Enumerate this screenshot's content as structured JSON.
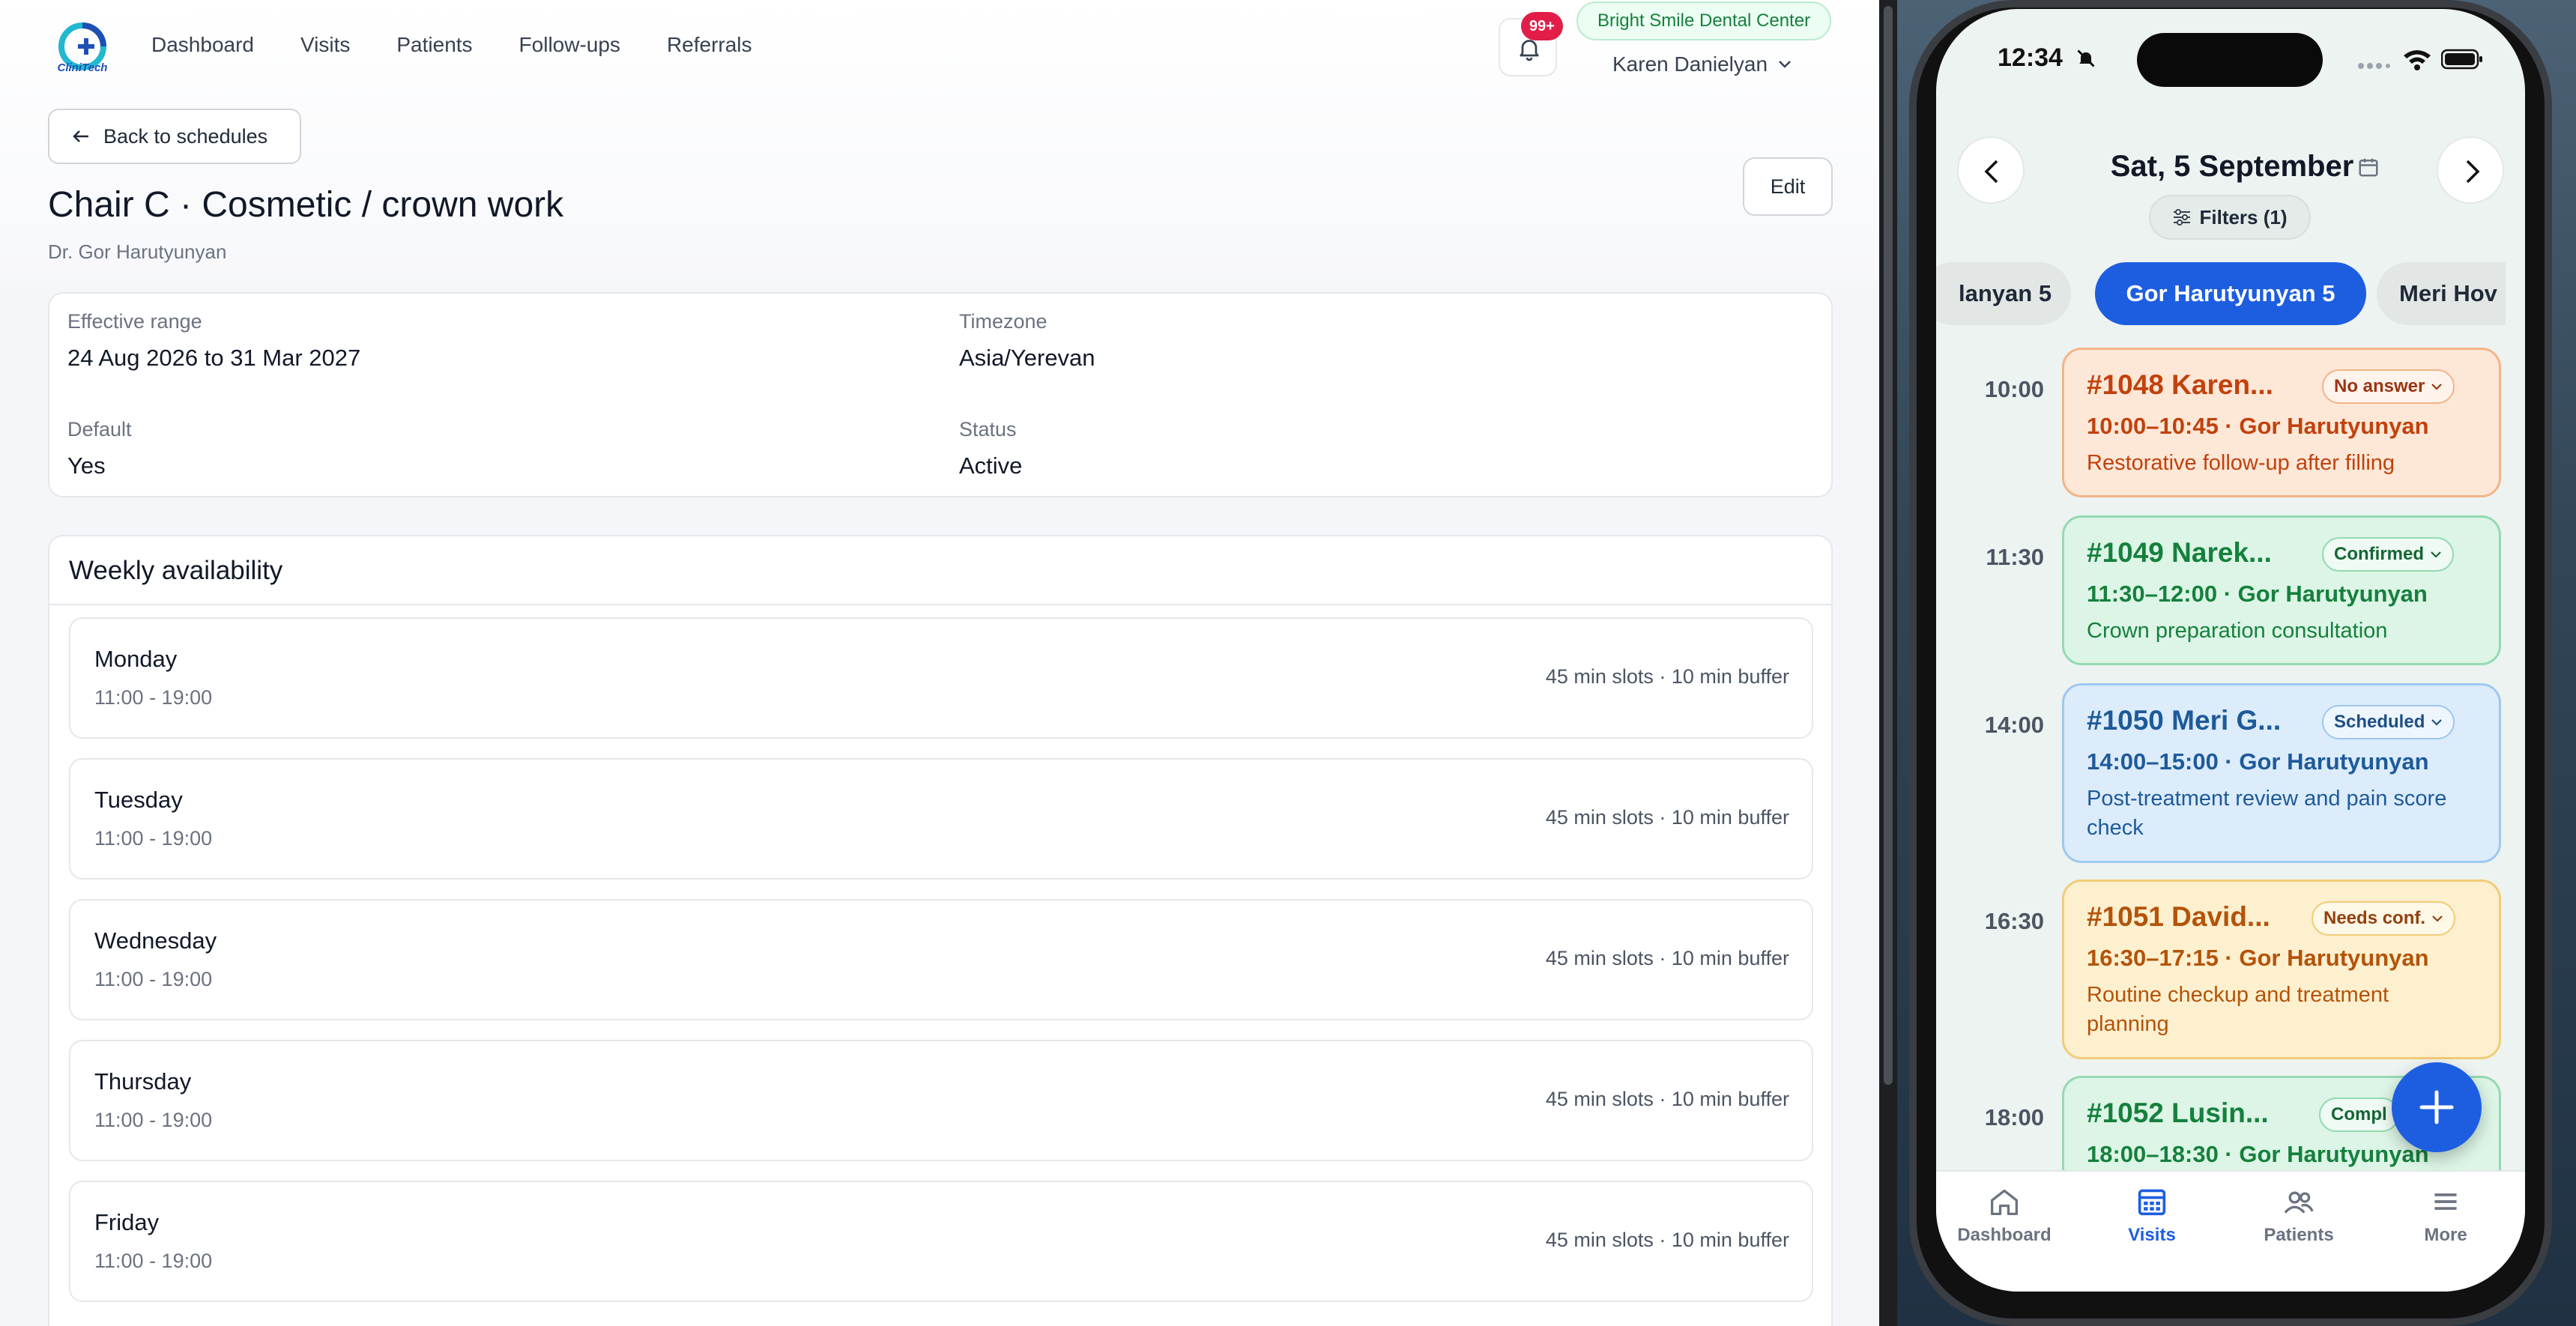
{
  "web": {
    "logo_text": "CliniTech",
    "nav": [
      "Dashboard",
      "Visits",
      "Patients",
      "Follow-ups",
      "Referrals"
    ],
    "notifications_badge": "99+",
    "clinic_name": "Bright Smile Dental Center",
    "user_name": "Karen Danielyan",
    "back_label": "Back to schedules",
    "title": "Chair C · Cosmetic / crown work",
    "doctor": "Dr. Gor Harutyunyan",
    "edit_label": "Edit",
    "info": {
      "effective_range_label": "Effective range",
      "effective_range_value": "24 Aug 2026 to 31 Mar 2027",
      "timezone_label": "Timezone",
      "timezone_value": "Asia/Yerevan",
      "default_label": "Default",
      "default_value": "Yes",
      "status_label": "Status",
      "status_value": "Active"
    },
    "weekly_title": "Weekly availability",
    "days": [
      {
        "name": "Monday",
        "hours": "11:00 - 19:00",
        "meta": "45 min slots · 10 min buffer"
      },
      {
        "name": "Tuesday",
        "hours": "11:00 - 19:00",
        "meta": "45 min slots · 10 min buffer"
      },
      {
        "name": "Wednesday",
        "hours": "11:00 - 19:00",
        "meta": "45 min slots · 10 min buffer"
      },
      {
        "name": "Thursday",
        "hours": "11:00 - 19:00",
        "meta": "45 min slots · 10 min buffer"
      },
      {
        "name": "Friday",
        "hours": "11:00 - 19:00",
        "meta": "45 min slots · 10 min buffer"
      }
    ]
  },
  "phone": {
    "status_time": "12:34",
    "date_title": "Sat, 5 September",
    "filters_label": "Filters (1)",
    "chips": [
      "lanyan 5",
      "Gor Harutyunyan 5",
      "Meri Hov"
    ],
    "appointments": [
      {
        "time": "10:00",
        "title": "#1048 Karen...",
        "badge": "No answer",
        "range": "10:00–10:45 · Gor Harutyunyan",
        "desc": "Restorative follow-up after filling"
      },
      {
        "time": "11:30",
        "title": "#1049 Narek...",
        "badge": "Confirmed",
        "range": "11:30–12:00 · Gor Harutyunyan",
        "desc": "Crown preparation consultation"
      },
      {
        "time": "14:00",
        "title": "#1050 Meri G...",
        "badge": "Scheduled",
        "range": "14:00–15:00 · Gor Harutyunyan",
        "desc": "Post-treatment review and pain score check"
      },
      {
        "time": "16:30",
        "title": "#1051 David...",
        "badge": "Needs conf.",
        "range": "16:30–17:15 · Gor Harutyunyan",
        "desc": "Routine checkup and treatment planning"
      },
      {
        "time": "18:00",
        "title": "#1052 Lusin...",
        "badge": "Compl",
        "range": "18:00–18:30 · Gor Harutyunyan",
        "desc": ""
      }
    ],
    "tabs": [
      "Dashboard",
      "Visits",
      "Patients",
      "More"
    ]
  },
  "colors": {
    "accent": "#1d5ee0",
    "orange_bg": "#fde8d8",
    "orange_border": "#f3b488",
    "orange_text": "#c2410c",
    "green_bg": "#dcf5e6",
    "green_border": "#95d9b2",
    "green_text": "#15803d",
    "blue_bg": "#dcecfb",
    "blue_border": "#9ec8f0",
    "blue_text": "#1e5a9a",
    "amber_bg": "#fdf0cf",
    "amber_border": "#f1cc78",
    "amber_text": "#b45309"
  }
}
